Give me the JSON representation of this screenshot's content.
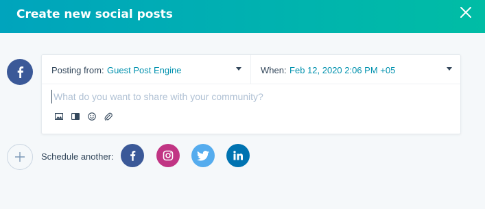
{
  "header": {
    "title": "Create new social posts"
  },
  "icons": {
    "close": "close-icon",
    "account": "facebook-icon",
    "add": "plus-icon"
  },
  "composer": {
    "posting_from_label": "Posting from:",
    "posting_from_value": "Guest Post Engine",
    "when_label": "When:",
    "when_value": "Feb 12, 2020 2:06 PM +05",
    "post_placeholder": "What do you want to share with your community?",
    "post_value": "",
    "toolbar": [
      "image-icon",
      "video-icon",
      "emoji-icon",
      "attachment-icon"
    ]
  },
  "schedule": {
    "label": "Schedule another:",
    "networks": [
      {
        "name": "facebook",
        "color": "#3b5998"
      },
      {
        "name": "instagram",
        "color": "#c13584"
      },
      {
        "name": "twitter",
        "color": "#55acee"
      },
      {
        "name": "linkedin",
        "color": "#0073b1"
      }
    ]
  },
  "colors": {
    "header_start": "#00a4bd",
    "header_end": "#00bda5",
    "link": "#0091ae",
    "background": "#f5f8fa"
  }
}
